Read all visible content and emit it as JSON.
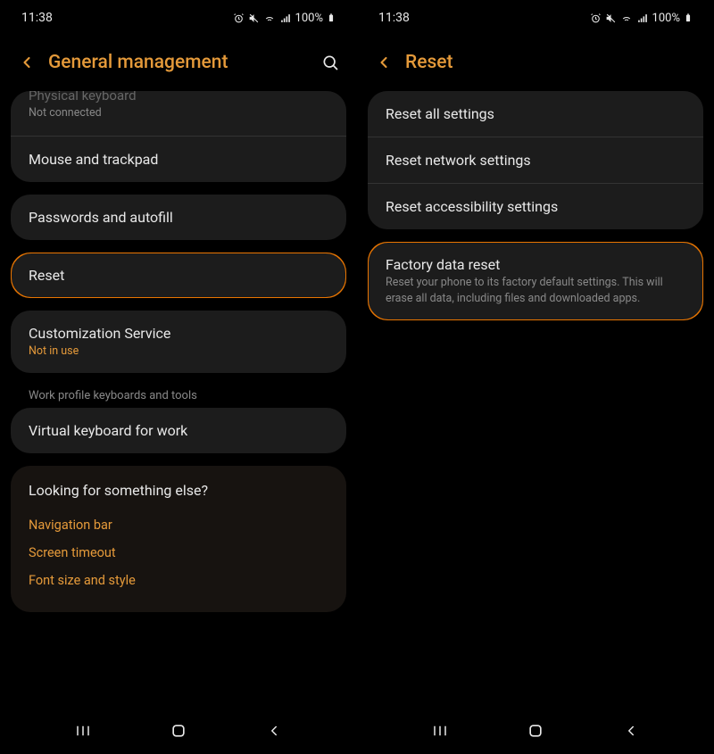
{
  "status": {
    "time": "11:38",
    "battery": "100%"
  },
  "left": {
    "title": "General management",
    "physical_keyboard": {
      "title": "Physical keyboard",
      "sub": "Not connected"
    },
    "mouse": {
      "title": "Mouse and trackpad"
    },
    "passwords": {
      "title": "Passwords and autofill"
    },
    "reset": {
      "title": "Reset"
    },
    "customization": {
      "title": "Customization Service",
      "sub": "Not in use"
    },
    "work_section": "Work profile keyboards and tools",
    "virtual_work": {
      "title": "Virtual keyboard for work"
    },
    "suggest": {
      "title": "Looking for something else?",
      "links": [
        "Navigation bar",
        "Screen timeout",
        "Font size and style"
      ]
    }
  },
  "right": {
    "title": "Reset",
    "items": {
      "all": "Reset all settings",
      "network": "Reset network settings",
      "accessibility": "Reset accessibility settings"
    },
    "factory": {
      "title": "Factory data reset",
      "sub": "Reset your phone to its factory default settings. This will erase all data, including files and downloaded apps."
    }
  }
}
